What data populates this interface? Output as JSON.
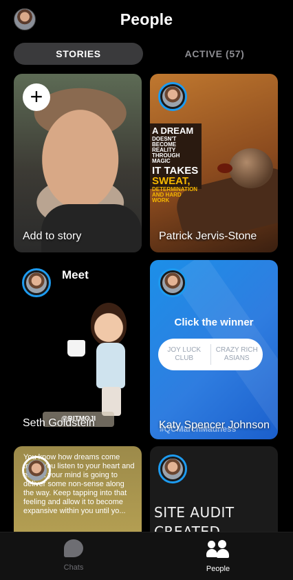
{
  "header": {
    "title": "People"
  },
  "tabs": {
    "stories": "STORIES",
    "active": "ACTIVE (57)"
  },
  "cards": [
    {
      "label": "Add to story",
      "plus": "+"
    },
    {
      "label": "Patrick Jervis-Stone",
      "poster": [
        "A DREAM",
        "DOESN'T BECOME",
        "REALITY THROUGH MAGIC",
        "IT TAKES",
        "SWEAT,",
        "DETERMINATION",
        "AND HARD WORK"
      ]
    },
    {
      "label": "Seth Goldstein",
      "title": "Meet",
      "tag": "@BITMOJI"
    },
    {
      "label": "Katy Spencer Johnson",
      "question": "Click the winner",
      "options": [
        "JOY LUCK CLUB",
        "CRAZY RICH ASIANS"
      ],
      "hashtag": "#QCMarchMadness"
    },
    {
      "text": "You know how dreams come true? You listen to your heart and expect your mind is going to deliver some non-sense along the way. Keep tapping into that feeling and allow it to become expansive within you until yo..."
    },
    {
      "text": "SITE AUDIT CREATED NOW"
    }
  ],
  "tabbar": {
    "chats": "Chats",
    "people": "People"
  },
  "colors": {
    "story_ring": "#1d9bf0",
    "active_tab_bg": "#3a3a3c",
    "background": "#000000"
  },
  "icons": {
    "add": "plus-icon",
    "chats": "chat-bubble-icon",
    "people": "people-icon"
  }
}
